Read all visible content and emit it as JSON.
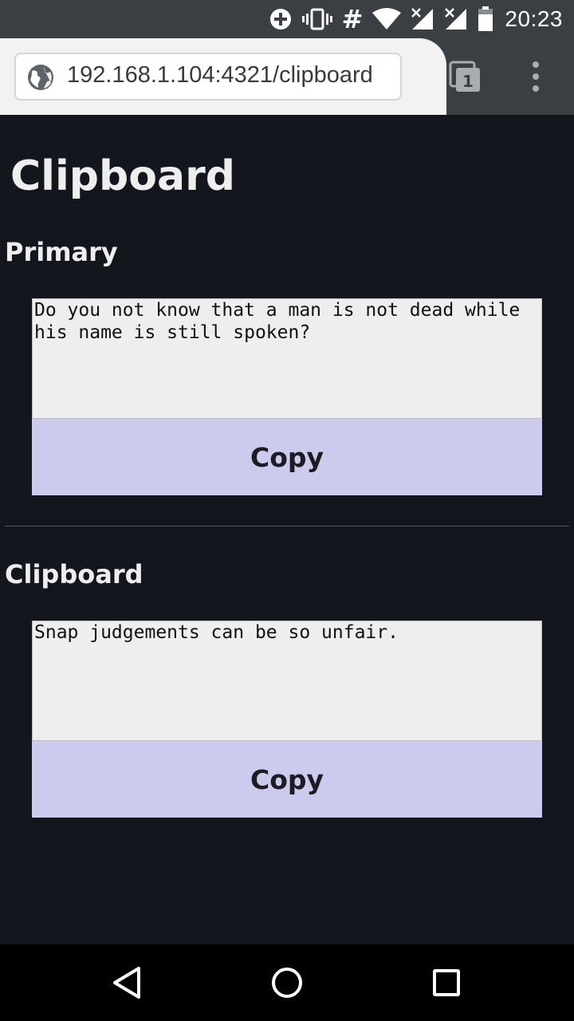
{
  "status_bar": {
    "time": "20:23",
    "icons": [
      "data-saver-icon",
      "vibrate-icon",
      "hash-icon",
      "wifi-icon",
      "signal-no-data-icon",
      "signal-no-data-icon",
      "battery-icon"
    ]
  },
  "browser": {
    "url": "192.168.1.104:4321/clipboard",
    "tab_count": "1"
  },
  "page": {
    "title": "Clipboard",
    "sections": [
      {
        "heading": "Primary",
        "text": "Do you not know that a man is not dead while his name is still spoken?",
        "button_label": "Copy"
      },
      {
        "heading": "Clipboard",
        "text": "Snap judgements can be so unfair.",
        "button_label": "Copy"
      }
    ]
  },
  "nav_bar": {
    "icons": [
      "back-icon",
      "home-icon",
      "recents-icon"
    ]
  }
}
